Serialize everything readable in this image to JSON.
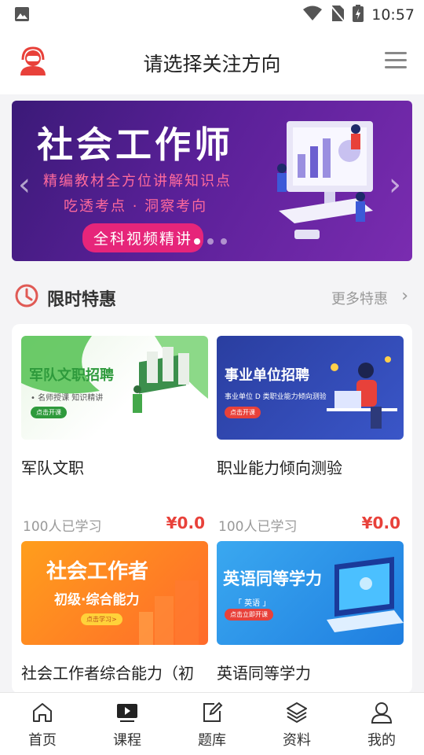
{
  "status_bar": {
    "time": "10:57"
  },
  "header": {
    "title": "请选择关注方向"
  },
  "banner": {
    "title": "社会工作师",
    "line1": "精编教材全方位讲解知识点",
    "line2": "吃透考点 · 洞察考向",
    "pill": "全科视频精讲",
    "page_count": 3,
    "active_page": 1
  },
  "section": {
    "title": "限时特惠",
    "more": "更多特惠"
  },
  "cards": [
    {
      "name": "军队文职",
      "learners": "100人已学习",
      "price": "¥0.0",
      "thumb": {
        "title": "军队文职招聘",
        "sub": "• 名师授课  知识精讲",
        "button": "点击开课"
      }
    },
    {
      "name": "职业能力倾向测验",
      "learners": "100人已学习",
      "price": "¥0.0",
      "thumb": {
        "title": "事业单位招聘",
        "sub": "事业单位 D 类职业能力倾向测验",
        "button": "点击开课"
      }
    },
    {
      "name": "社会工作者综合能力（初",
      "thumb": {
        "title": "社会工作者",
        "sub": "初级·综合能力",
        "button": "点击学习>"
      }
    },
    {
      "name": "英语同等学力",
      "thumb": {
        "title": "英语同等学力",
        "sub": "「 英语 」",
        "button": "点击立即开课"
      }
    }
  ],
  "tabs": [
    {
      "label": "首页",
      "icon": "home-icon"
    },
    {
      "label": "课程",
      "icon": "video-icon"
    },
    {
      "label": "题库",
      "icon": "edit-icon"
    },
    {
      "label": "资料",
      "icon": "layers-icon"
    },
    {
      "label": "我的",
      "icon": "user-icon"
    }
  ],
  "colors": {
    "accent": "#e8413a",
    "banner_pink": "#e6257a",
    "banner_purple": "#5a2098"
  }
}
